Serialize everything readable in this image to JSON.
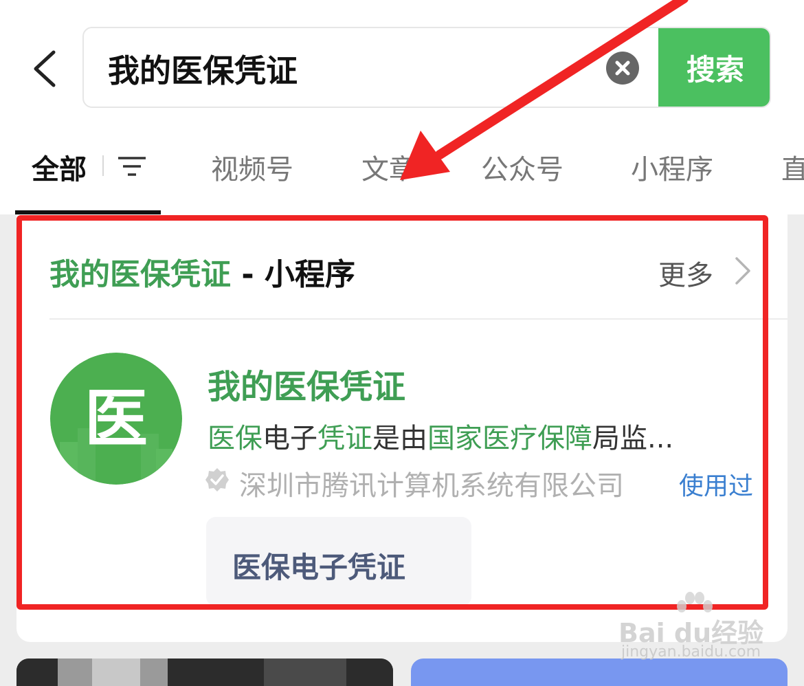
{
  "search": {
    "query": "我的医保凭证",
    "button_label": "搜索"
  },
  "tabs": [
    {
      "label": "全部",
      "active": true
    },
    {
      "label": "视频号"
    },
    {
      "label": "文章"
    },
    {
      "label": "公众号"
    },
    {
      "label": "小程序"
    },
    {
      "label": "直"
    }
  ],
  "section": {
    "title_keyword": "我的医保凭证",
    "title_suffix": " - 小程序",
    "more_label": "更多"
  },
  "result": {
    "icon_glyph": "医",
    "icon_color": "#4caf50",
    "name": "我的医保凭证",
    "description_parts": [
      {
        "text": "医保",
        "highlight": true
      },
      {
        "text": "电子",
        "highlight": false
      },
      {
        "text": "凭证",
        "highlight": true
      },
      {
        "text": "是由",
        "highlight": false
      },
      {
        "text": "国家医疗保障",
        "highlight": true
      },
      {
        "text": "局监...",
        "highlight": false
      }
    ],
    "developer": "深圳市腾讯计算机系统有限公司",
    "used_badge": "使用过",
    "service_label": "医保电子凭证"
  },
  "watermark": {
    "brand": "Bai du经验",
    "url": "jingyan.baidu.com"
  },
  "colors": {
    "accent_green": "#4bc060",
    "keyword_green": "#3f9e54",
    "annotation_red": "#f02424",
    "link_blue": "#3a7fd0"
  }
}
